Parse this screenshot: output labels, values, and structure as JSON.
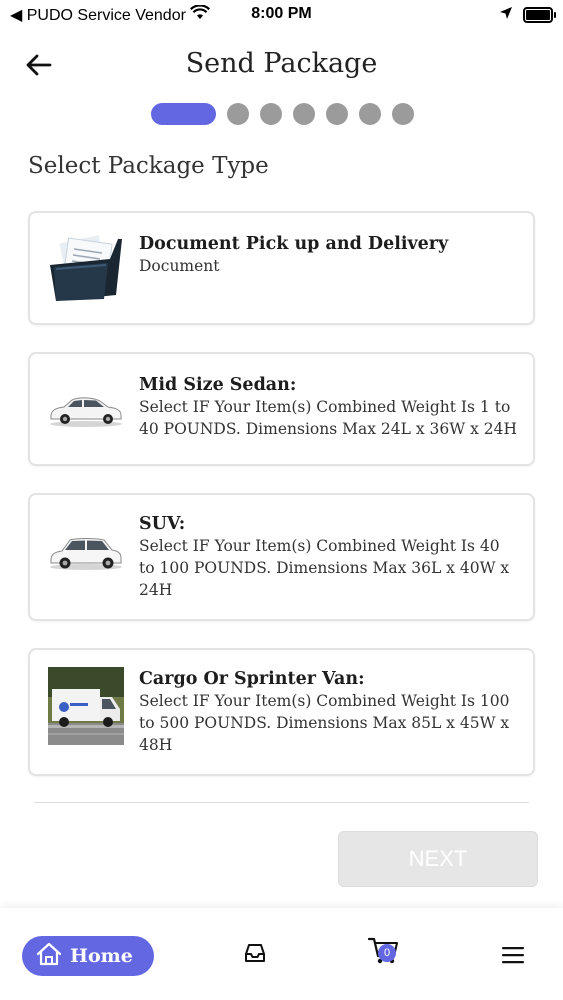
{
  "status_bar": {
    "carrier": "◀ PUDO Service Vendor",
    "time": "8:00 PM"
  },
  "header": {
    "title": "Send Package"
  },
  "stepper": {
    "total_steps": 7,
    "current_step": 1
  },
  "section_title": "Select Package Type",
  "package_types": [
    {
      "title": "Document Pick up and Delivery",
      "description": "Document",
      "icon": "document-folder-icon"
    },
    {
      "title": "Mid Size Sedan:",
      "description": "Select IF Your Item(s) Combined Weight Is 1 to 40 POUNDS. Dimensions Max 24L x 36W x 24H",
      "icon": "sedan-car-icon"
    },
    {
      "title": "SUV:",
      "description": "Select IF Your Item(s) Combined Weight Is 40 to 100 POUNDS. Dimensions Max 36L x 40W x 24H",
      "icon": "suv-car-icon"
    },
    {
      "title": "Cargo Or Sprinter Van:",
      "description": "Select IF Your Item(s) Combined Weight Is 100 to 500 POUNDS. Dimensions Max 85L x 45W x 48H",
      "icon": "cargo-van-icon"
    }
  ],
  "next_button": {
    "label": "NEXT",
    "enabled": false
  },
  "bottom_nav": {
    "home_label": "Home",
    "cart_count": "0"
  },
  "colors": {
    "accent": "#6367e2",
    "step_inactive": "#9b9b9b",
    "card_border": "#e3e3e3",
    "disabled_button": "#e6e6e6"
  }
}
